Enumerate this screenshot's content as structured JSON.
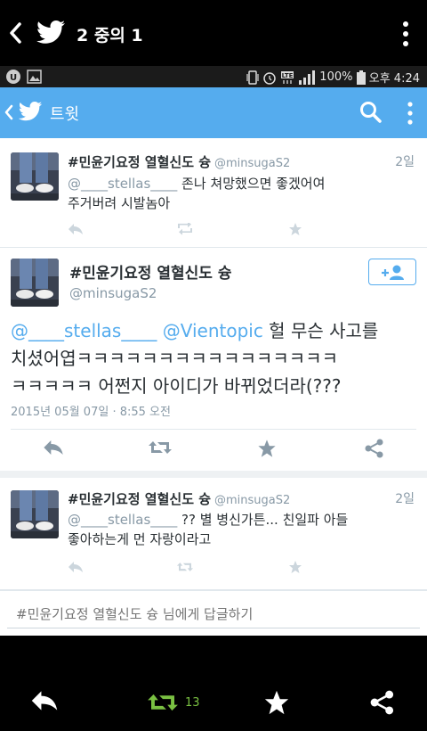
{
  "viewer": {
    "title": "2 중의 1"
  },
  "status": {
    "battery": "100%",
    "time": "오후 4:24"
  },
  "app_bar": {
    "title": "트윗"
  },
  "tweets": [
    {
      "name": "#민윤기요정 열혈신도 슝",
      "handle": "@minsugaS2",
      "time": "2일",
      "mention": "@____stellas____",
      "text_line1": " 존나 쳐망했으면 좋겠어여",
      "text_line2": "주거버려 시발놈아"
    },
    {
      "name": "#민윤기요정 열혈신도 슝",
      "handle": "@minsugaS2",
      "time": "2일",
      "mention": "@____stellas____",
      "text_line1": " ?? 별 병신가튼... 친일파 아들",
      "text_line2": "좋아하는게 먼 자랑이라고"
    }
  ],
  "detail": {
    "name": "#민윤기요정 열혈신도 슝",
    "handle": "@minsugaS2",
    "mention1": "@____stellas____",
    "mention2": "@Vientopic",
    "text_line1": " 헐 무슨 사고를",
    "text_line2": "치셨어엽ㅋㅋㅋㅋㅋㅋㅋㅋㅋㅋㅋㅋㅋㅋㅋㅋ",
    "text_line3": "ㅋㅋㅋㅋㅋ 어쩐지 아이디가 바뀌었더라(???",
    "date": "2015년 05월 07일 · 8:55 오전"
  },
  "reply": {
    "placeholder": "#민윤기요정 열혈신도 슝 님에게 답글하기"
  },
  "bottom": {
    "retweet_count": "13"
  },
  "colors": {
    "twitter_blue": "#55acee",
    "retweet_green": "#7ac142",
    "muted": "#8899a6"
  }
}
